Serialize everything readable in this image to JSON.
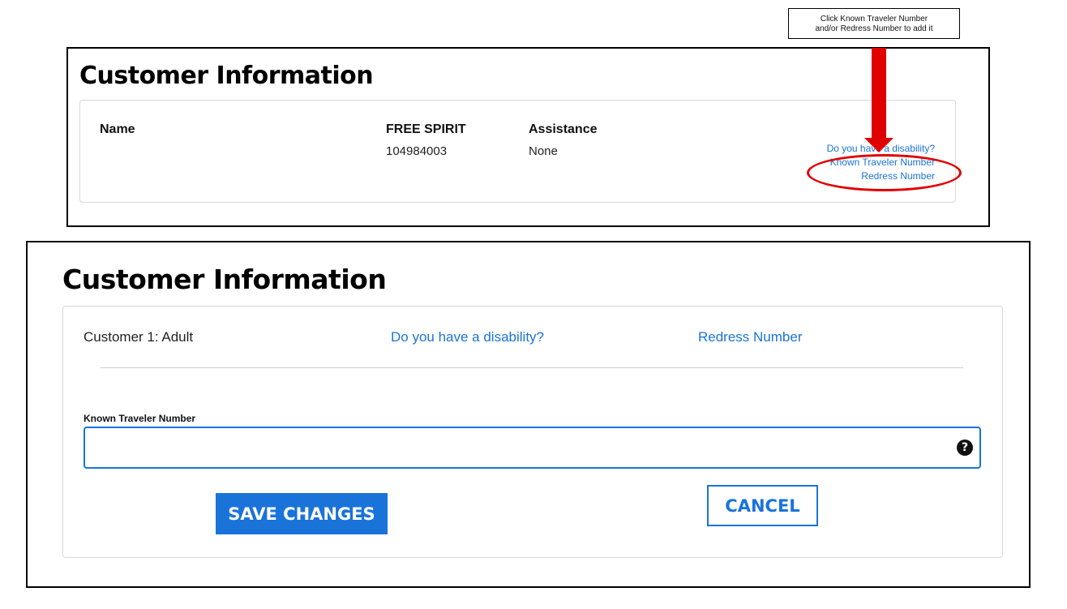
{
  "callout": {
    "line1": "Click Known Traveler Number",
    "line2": "and/or Redress Number to add it"
  },
  "top_panel": {
    "title": "Customer Information",
    "name_label": "Name",
    "member_name": "FREE SPIRIT",
    "member_number": "104984003",
    "assistance_label": "Assistance",
    "assistance_value": "None",
    "links": {
      "disability": "Do you have a disability?",
      "known_traveler": "Known Traveler Number",
      "redress": "Redress Number"
    }
  },
  "bottom_panel": {
    "title": "Customer Information",
    "customer_label": "Customer 1: Adult",
    "disability_link": "Do you have a disability?",
    "redress_link": "Redress Number",
    "ktn_label": "Known Traveler Number",
    "ktn_value": "",
    "help_icon_glyph": "?",
    "save_label": "SAVE CHANGES",
    "cancel_label": "CANCEL"
  },
  "colors": {
    "accent": "#1a73d9",
    "annotation": "#e00000"
  }
}
